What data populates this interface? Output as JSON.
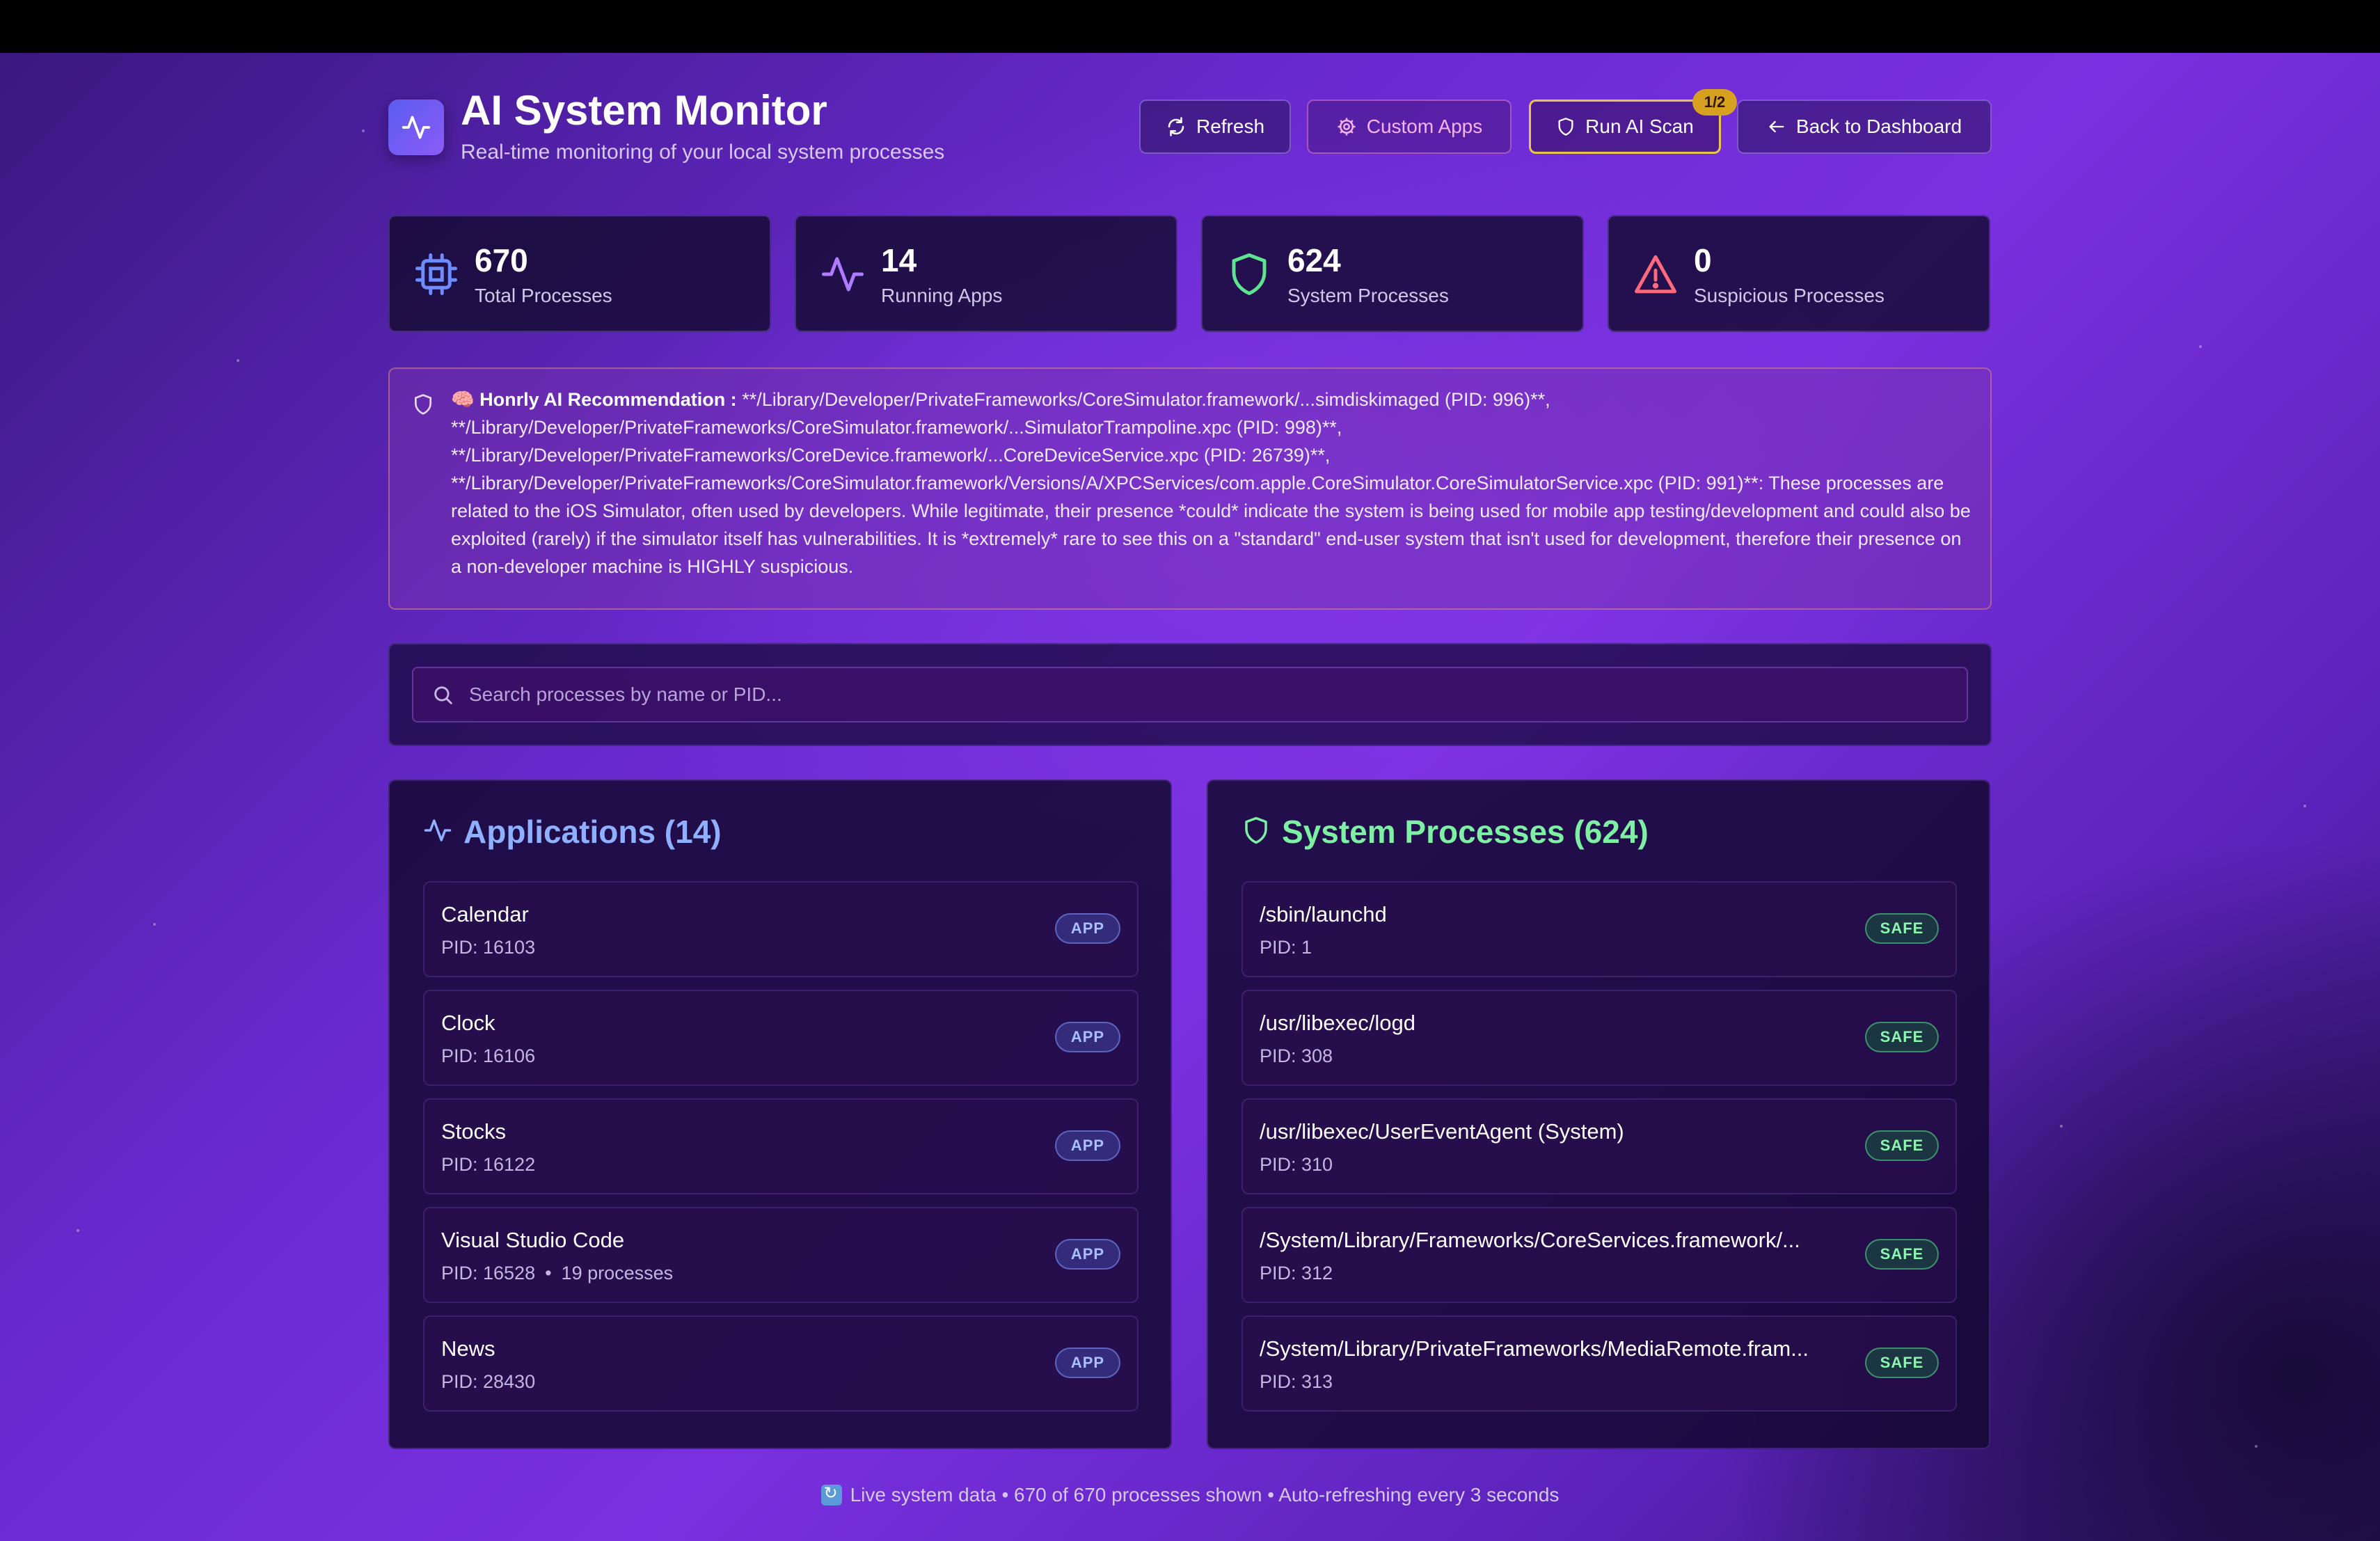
{
  "header": {
    "title": "AI System Monitor",
    "subtitle": "Real-time monitoring of your local system processes",
    "buttons": {
      "refresh": "Refresh",
      "custom_apps": "Custom Apps",
      "run_ai_scan": "Run AI Scan",
      "scan_badge": "1/2",
      "back": "Back to Dashboard"
    }
  },
  "stats": [
    {
      "value": "670",
      "label": "Total Processes",
      "icon": "cpu-icon",
      "color": "#6f8cff"
    },
    {
      "value": "14",
      "label": "Running Apps",
      "icon": "activity-icon",
      "color": "#b07cff"
    },
    {
      "value": "624",
      "label": "System Processes",
      "icon": "shield-icon",
      "color": "#5ee48e"
    },
    {
      "value": "0",
      "label": "Suspicious Processes",
      "icon": "warning-icon",
      "color": "#ff6b7a"
    }
  ],
  "recommendation": {
    "emoji": "🧠",
    "title": "Honrly AI Recommendation :",
    "text": " **/Library/Developer/PrivateFrameworks/CoreSimulator.framework/...simdiskimaged (PID: 996)**, **/Library/Developer/PrivateFrameworks/CoreSimulator.framework/...SimulatorTrampoline.xpc (PID: 998)**, **/Library/Developer/PrivateFrameworks/CoreDevice.framework/...CoreDeviceService.xpc (PID: 26739)**, **/Library/Developer/PrivateFrameworks/CoreSimulator.framework/Versions/A/XPCServices/com.apple.CoreSimulator.CoreSimulatorService.xpc (PID: 991)**: These processes are related to the iOS Simulator, often used by developers. While legitimate, their presence *could* indicate the system is being used for mobile app testing/development and could also be exploited (rarely) if the simulator itself has vulnerabilities. It is *extremely* rare to see this on a \"standard\" end-user system that isn't used for development, therefore their presence on a non-developer machine is HIGHLY suspicious."
  },
  "search": {
    "placeholder": "Search processes by name or PID..."
  },
  "applications": {
    "heading": "Applications (14)",
    "items": [
      {
        "name": "Calendar",
        "pid": "PID: 16103",
        "extra": "",
        "badge": "APP"
      },
      {
        "name": "Clock",
        "pid": "PID: 16106",
        "extra": "",
        "badge": "APP"
      },
      {
        "name": "Stocks",
        "pid": "PID: 16122",
        "extra": "",
        "badge": "APP"
      },
      {
        "name": "Visual Studio Code",
        "pid": "PID: 16528",
        "extra": "19 processes",
        "badge": "APP"
      },
      {
        "name": "News",
        "pid": "PID: 28430",
        "extra": "",
        "badge": "APP"
      }
    ]
  },
  "system": {
    "heading": "System Processes (624)",
    "items": [
      {
        "name": "/sbin/launchd",
        "pid": "PID: 1",
        "badge": "SAFE"
      },
      {
        "name": "/usr/libexec/logd",
        "pid": "PID: 308",
        "badge": "SAFE"
      },
      {
        "name": "/usr/libexec/UserEventAgent (System)",
        "pid": "PID: 310",
        "badge": "SAFE"
      },
      {
        "name": "/System/Library/Frameworks/CoreServices.framework/...",
        "pid": "PID: 312",
        "badge": "SAFE"
      },
      {
        "name": "/System/Library/PrivateFrameworks/MediaRemote.fram...",
        "pid": "PID: 313",
        "badge": "SAFE"
      }
    ]
  },
  "footer": {
    "text": "Live system data • 670 of 670 processes shown • Auto-refreshing every 3 seconds"
  }
}
